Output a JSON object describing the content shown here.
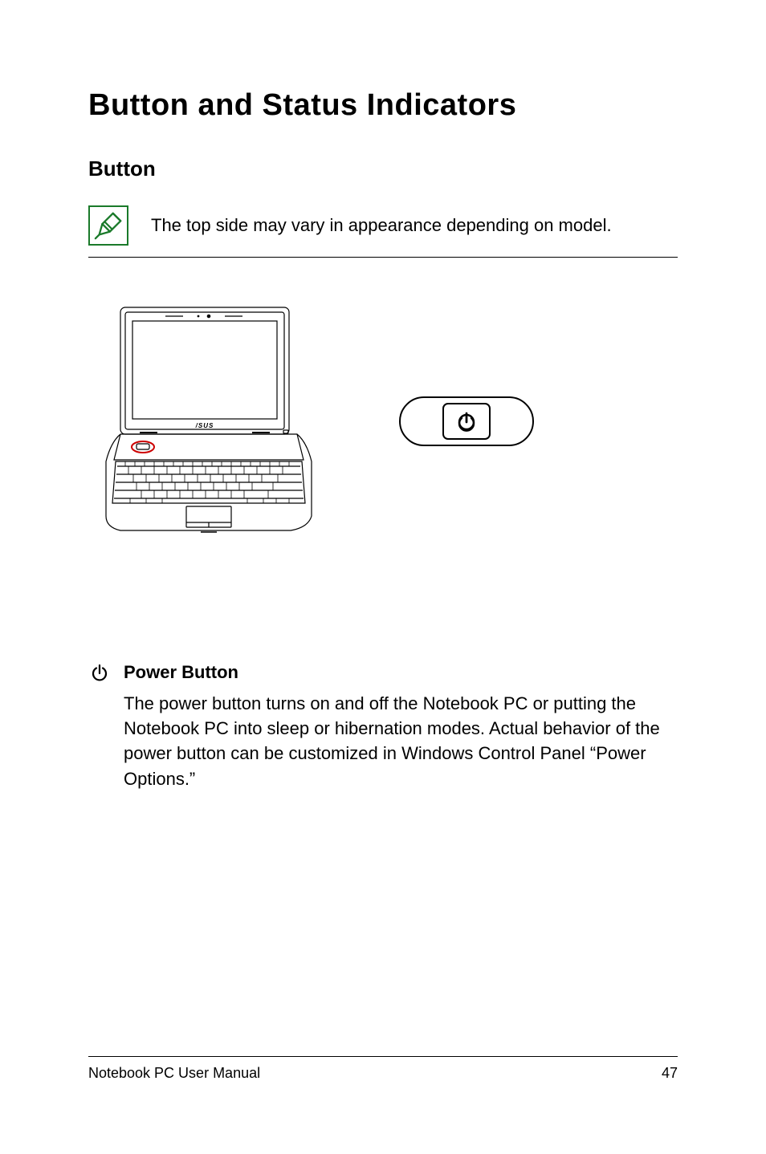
{
  "heading1": "Button and Status Indicators",
  "heading2": "Button",
  "note": {
    "text": "The top side may vary in appearance depending on model."
  },
  "power_section": {
    "heading": "Power Button",
    "body": "The power button turns on and off the Notebook PC or putting the Notebook PC into sleep or hibernation modes. Actual behavior of the power button can be customized in Windows Control Panel “Power Options.”"
  },
  "footer": {
    "doc_title": "Notebook PC User Manual",
    "page_number": "47"
  }
}
